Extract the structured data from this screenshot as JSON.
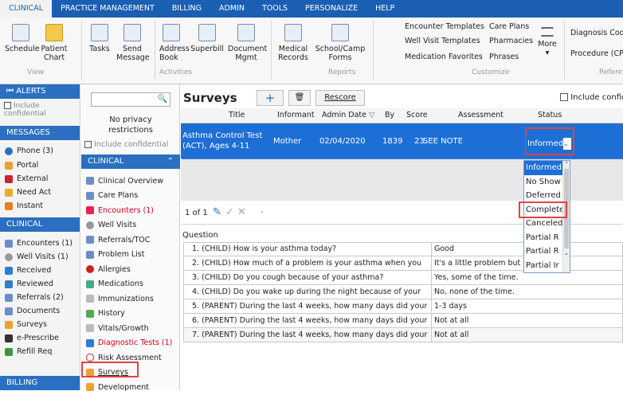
{
  "menu": [
    "CLINICAL",
    "PRACTICE MANAGEMENT",
    "BILLING",
    "ADMIN",
    "TOOLS",
    "PERSONALIZE",
    "HELP"
  ],
  "ribbon": {
    "schedule": "Schedule",
    "patient_chart": [
      "Patient",
      "Chart"
    ],
    "tasks": "Tasks",
    "send_message": [
      "Send",
      "Message"
    ],
    "address_book": [
      "Address",
      "Book"
    ],
    "superbill": "Superbill",
    "document_mgmt": [
      "Document",
      "Mgmt"
    ],
    "medical_records": [
      "Medical",
      "Records"
    ],
    "school_camp_forms": [
      "School/Camp",
      "Forms"
    ],
    "encounter_templates": "Encounter Templates",
    "well_visit_templates": "Well Visit Templates",
    "medication_favorites": "Medication Favorites",
    "care_plans": "Care Plans",
    "pharmacies": "Pharmacies",
    "phrases": "Phrases",
    "more": "More",
    "diagnosis_codes": "Diagnosis Code",
    "procedure": "Procedure (CPT",
    "group_view": "View",
    "group_activities": "Activities",
    "group_reports": "Reports",
    "group_customize": "Customize",
    "group_reference": "Refere"
  },
  "left_a": {
    "alerts": "ALERTS",
    "include_conf": [
      "Include",
      "confidential"
    ],
    "messages": "MESSAGES",
    "msg_items": [
      "Phone (3)",
      "Portal",
      "External",
      "Need Act",
      "Instant"
    ],
    "clinical": "CLINICAL",
    "clinical_items": [
      "Encounters (1)",
      "Well Visits (1)",
      "Received",
      "Reviewed",
      "Referrals (2)",
      "Documents",
      "Surveys",
      "e-Prescribe",
      "Refill Req"
    ],
    "billing": "BILLING"
  },
  "left_b": {
    "privacy": [
      "No privacy",
      "restrictions"
    ],
    "include_conf": "Include confidential",
    "clinical": "CLINICAL",
    "items": [
      "Clinical Overview",
      "Care Plans",
      "Encounters (1)",
      "Well Visits",
      "Referrals/TOC",
      "Problem List",
      "Allergies",
      "Medications",
      "Immunizations",
      "History",
      "Vitals/Growth",
      "Diagnostic Tests (1)",
      "Risk Assessment",
      "Surveys",
      "Development"
    ]
  },
  "main": {
    "title": "Surveys",
    "rescore": "Rescore",
    "include_conf": "Include confide",
    "columns": [
      "Title",
      "Informant",
      "Admin Date",
      "By",
      "Score",
      "Assessment",
      "Status"
    ],
    "row": {
      "title": [
        "Asthma Control Test",
        "(ACT), Ages 4-11"
      ],
      "informant": "Mother",
      "admin_date": "02/04/2020",
      "by": "1839",
      "score": "23",
      "assessment": "SEE NOTE",
      "status": "Informed"
    },
    "pager": "1 of 1",
    "question_header": "Question",
    "questions": [
      {
        "q": "1. (CHILD) How is your asthma today?",
        "a": "Good"
      },
      {
        "q": "2. (CHILD) How much of a problem is your asthma when you",
        "a": "It's a little problem but it's"
      },
      {
        "q": "3. (CHILD) Do you cough because of your asthma?",
        "a": "Yes, some of the time."
      },
      {
        "q": "4. (CHILD) Do you wake up during the night because of your",
        "a": "No, none of the time."
      },
      {
        "q": "5. (PARENT) During the last 4 weeks, how many days did your",
        "a": "1-3 days"
      },
      {
        "q": "6. (PARENT) During the last 4 weeks, how many days did your",
        "a": "Not at all"
      },
      {
        "q": "7. (PARENT) During the last 4 weeks, how many days did your",
        "a": "Not at all"
      }
    ],
    "dropdown": [
      "Informed",
      "No Show",
      "Deferred",
      "Complete",
      "Canceled",
      "Partial R",
      "Partial R",
      "Partial Ir"
    ]
  }
}
